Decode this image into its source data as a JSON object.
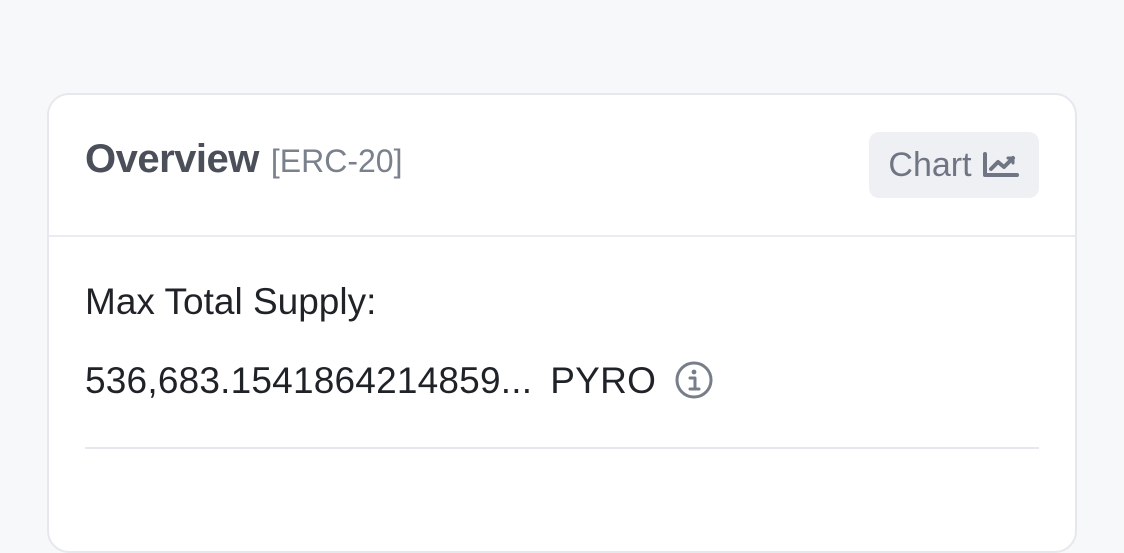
{
  "overview": {
    "title": "Overview",
    "subtitle": "[ERC-20]"
  },
  "header": {
    "chart_button_label": "Chart",
    "chart_icon": "chart-line-icon"
  },
  "supply": {
    "label": "Max Total Supply:",
    "amount": "536,683.1541864214859...",
    "symbol": "PYRO",
    "info_icon": "info-icon"
  },
  "colors": {
    "background": "#f7f8fa",
    "card": "#ffffff",
    "border": "#e6e8ee",
    "text_primary": "#1f2328",
    "text_muted": "#7a808c"
  }
}
